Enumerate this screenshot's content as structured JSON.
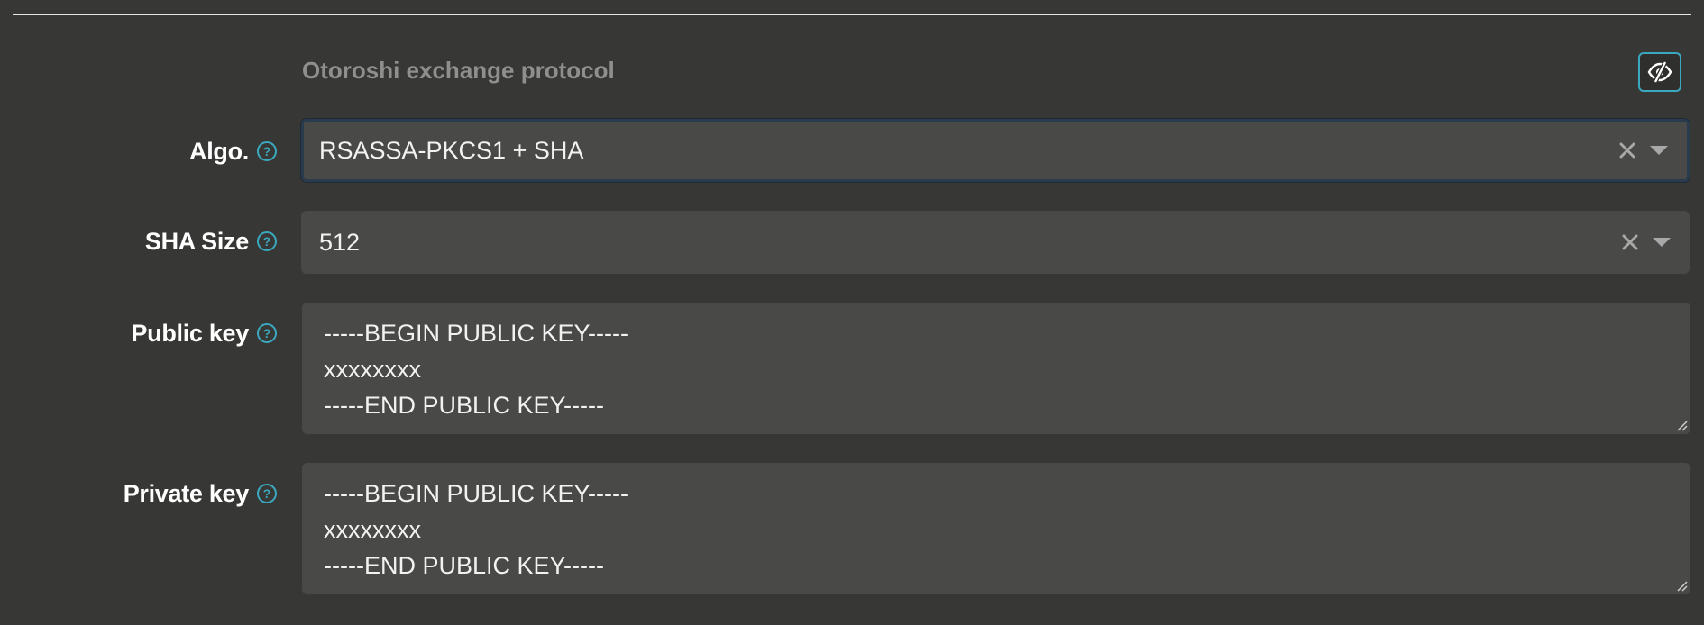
{
  "section": {
    "title": "Otoroshi exchange protocol",
    "toggle_icon": "eye-slash-icon",
    "accent_color": "#3aa8bf"
  },
  "fields": {
    "algo": {
      "label": "Algo.",
      "value": "RSASSA-PKCS1 + SHA",
      "help_icon": "question-circle-icon"
    },
    "sha_size": {
      "label": "SHA Size",
      "value": "512",
      "help_icon": "question-circle-icon"
    },
    "public_key": {
      "label": "Public key",
      "lines": [
        "-----BEGIN PUBLIC KEY-----",
        "xxxxxxxx",
        "-----END PUBLIC KEY-----"
      ],
      "help_icon": "question-circle-icon"
    },
    "private_key": {
      "label": "Private key",
      "lines": [
        "-----BEGIN PUBLIC KEY-----",
        "xxxxxxxx",
        "-----END PUBLIC KEY-----"
      ],
      "help_icon": "question-circle-icon"
    }
  }
}
